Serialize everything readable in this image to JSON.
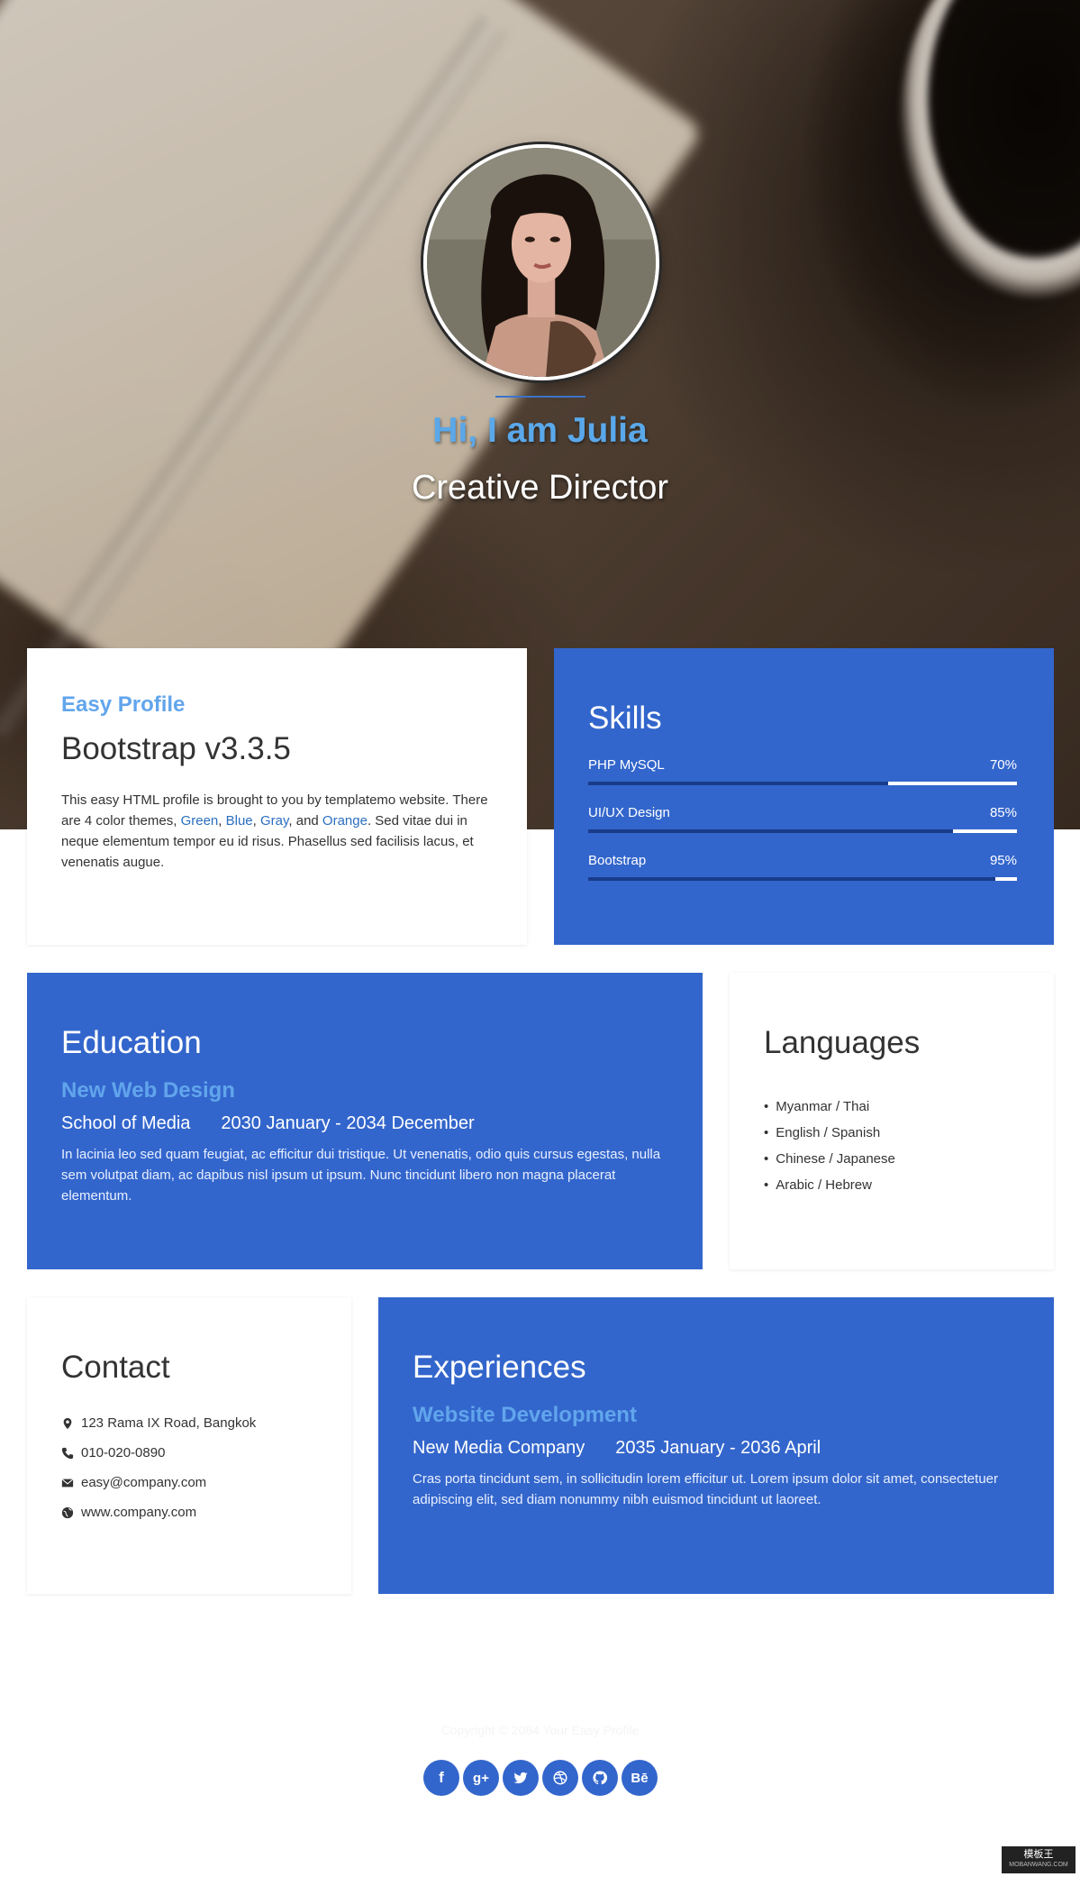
{
  "hero": {
    "greeting": "Hi, I am Julia",
    "role": "Creative Director"
  },
  "profile": {
    "heading": "Easy Profile",
    "subheading": "Bootstrap v3.3.5",
    "text_before": "This easy HTML profile is brought to you by templatemo website. There are 4 color themes, ",
    "themes": [
      "Green",
      "Blue",
      "Gray",
      "Orange"
    ],
    "sep_1": ", ",
    "sep_2": ", ",
    "sep_3": ", and ",
    "text_after": ". Sed vitae dui in neque elementum tempor eu id risus. Phasellus sed facilisis lacus, et venenatis augue."
  },
  "skills": {
    "title": "Skills",
    "items": [
      {
        "name": "PHP MySQL",
        "percent_label": "70%",
        "level": 0.7
      },
      {
        "name": "UI/UX Design",
        "percent_label": "85%",
        "level": 0.85
      },
      {
        "name": "Bootstrap",
        "percent_label": "95%",
        "level": 0.95
      }
    ]
  },
  "education": {
    "title": "Education",
    "course": "New Web Design",
    "school": "School of Media",
    "period": "2030 January - 2034 December",
    "description": "In lacinia leo sed quam feugiat, ac efficitur dui tristique. Ut venenatis, odio quis cursus egestas, nulla sem volutpat diam, ac dapibus nisl ipsum ut ipsum. Nunc tincidunt libero non magna placerat elementum."
  },
  "languages": {
    "title": "Languages",
    "items": [
      "Myanmar / Thai",
      "English / Spanish",
      "Chinese / Japanese",
      "Arabic / Hebrew"
    ]
  },
  "contact": {
    "title": "Contact",
    "address": "123 Rama IX Road, Bangkok",
    "phone": "010-020-0890",
    "email": "easy@company.com",
    "website": "www.company.com",
    "icons": [
      "map-marker-icon",
      "phone-icon",
      "envelope-icon",
      "globe-icon"
    ]
  },
  "experiences": {
    "title": "Experiences",
    "position": "Website Development",
    "company": "New Media Company",
    "period": "2035 January - 2036 April",
    "description": "Cras porta tincidunt sem, in sollicitudin lorem efficitur ut. Lorem ipsum dolor sit amet, consectetuer adipiscing elit, sed diam nonummy nibh euismod tincidunt ut laoreet."
  },
  "footer": {
    "copyright": "Copyright © 2084 Your Easy Profile",
    "social": [
      {
        "icon": "facebook-icon",
        "glyph": "f"
      },
      {
        "icon": "google-plus-icon",
        "glyph": "g+"
      },
      {
        "icon": "twitter-icon",
        "glyph": ""
      },
      {
        "icon": "dribbble-icon",
        "glyph": ""
      },
      {
        "icon": "github-icon",
        "glyph": ""
      },
      {
        "icon": "behance-icon",
        "glyph": "Bē"
      }
    ]
  },
  "watermark": {
    "line1": "模板王",
    "line2": "MOBANWANG.COM"
  },
  "colors": {
    "primary_blue": "#3366cc",
    "accent_light_blue": "#61a5ec",
    "bar_track": "#183c8a",
    "link_blue": "#2a6fc0"
  }
}
